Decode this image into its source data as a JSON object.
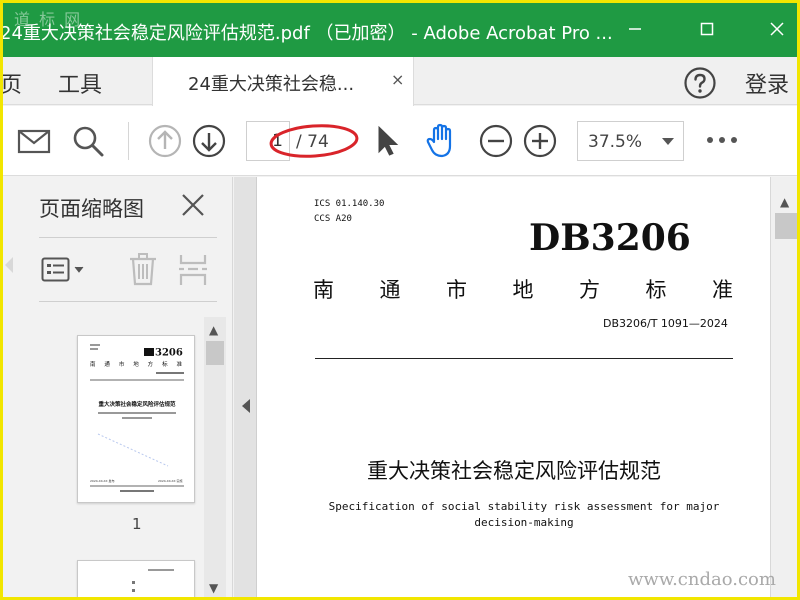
{
  "window": {
    "title": "24重大决策社会稳定风险评估规范.pdf （已加密） - Adobe Acrobat Pro ...",
    "logo_watermark": "道 标 网"
  },
  "tabs": {
    "home": "页",
    "tools": "工具",
    "document_tab": "24重大决策社会稳...",
    "document_tab_close": "×",
    "login": "登录"
  },
  "toolbar": {
    "page_current": "1",
    "page_total": "/ 74",
    "zoom": "37.5%"
  },
  "left_panel": {
    "title": "页面缩略图",
    "thumbnail_1_label": "1"
  },
  "document": {
    "ics": "ICS  01.140.30",
    "ccs": "CCS  A20",
    "code": "DB3206",
    "level": [
      "南",
      "通",
      "市",
      "地",
      "方",
      "标",
      "准"
    ],
    "number": "DB3206/T 1091—2024",
    "title_cn": "重大决策社会稳定风险评估规范",
    "title_en": "Specification of social stability risk assessment for major decision-making"
  },
  "thumbnail_text": {
    "code": "3206",
    "level": "南 通 市 地 方 标 准",
    "title_cn": "重大决策社会稳定风险评估规范",
    "date_left": "2024-XX-XX 发布",
    "date_right": "2024-XX-XX 实施"
  },
  "site_watermark": "www.cndao.com",
  "colors": {
    "title_bar": "#1f9a43",
    "accent_blue": "#1473e6",
    "annotation_red": "#d9242a",
    "frame_yellow": "#f2e600"
  }
}
